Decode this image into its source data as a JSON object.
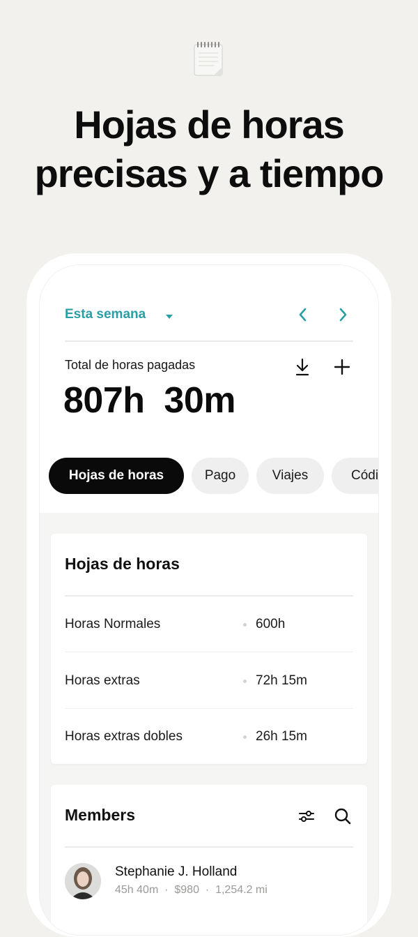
{
  "hero": {
    "icon": "notepad-icon",
    "headline_line1": "Hojas de horas",
    "headline_line2": "precisas y a tiempo"
  },
  "header": {
    "period_label": "Esta semana",
    "total_label": "Total de horas pagadas",
    "total_value": "807h  30m"
  },
  "tabs": [
    {
      "label": "Hojas de horas",
      "active": true
    },
    {
      "label": "Pago",
      "active": false
    },
    {
      "label": "Viajes",
      "active": false
    },
    {
      "label": "Códigos",
      "active": false
    }
  ],
  "timesheet_card": {
    "title": "Hojas de horas",
    "rows": [
      {
        "label": "Horas Normales",
        "value": "600h"
      },
      {
        "label": "Horas extras",
        "value": "72h 15m"
      },
      {
        "label": "Horas extras dobles",
        "value": "26h 15m"
      }
    ]
  },
  "members_card": {
    "title": "Members",
    "members": [
      {
        "name": "Stephanie J. Holland",
        "stats": "45h 40m  ·  $980  ·  1,254.2 mi"
      }
    ]
  },
  "colors": {
    "accent": "#2a9ea6",
    "background": "#f2f1ed",
    "tab_active": "#0a0a0a"
  }
}
